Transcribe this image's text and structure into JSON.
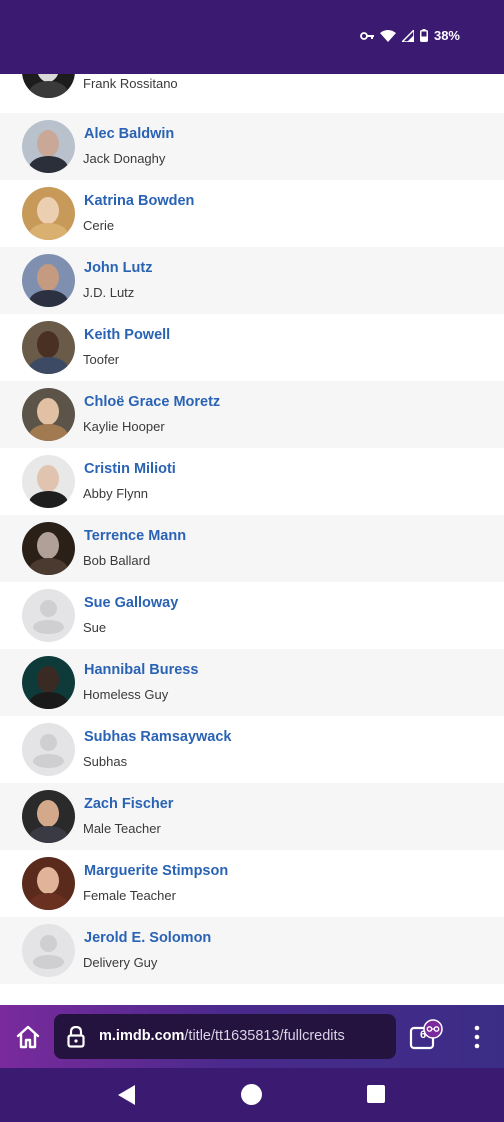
{
  "status_bar": {
    "battery_percent": "38%",
    "icons": [
      "vpn-key-icon",
      "wifi-icon",
      "cell-signal-icon",
      "battery-icon"
    ]
  },
  "cast": [
    {
      "actor": "",
      "character": "Frank Rossitano",
      "avatar": "photo"
    },
    {
      "actor": "Alec Baldwin",
      "character": "Jack Donaghy",
      "avatar": "photo"
    },
    {
      "actor": "Katrina Bowden",
      "character": "Cerie",
      "avatar": "photo"
    },
    {
      "actor": "John Lutz",
      "character": "J.D. Lutz",
      "avatar": "photo"
    },
    {
      "actor": "Keith Powell",
      "character": "Toofer",
      "avatar": "photo"
    },
    {
      "actor": "Chloë Grace Moretz",
      "character": "Kaylie Hooper",
      "avatar": "photo"
    },
    {
      "actor": "Cristin Milioti",
      "character": "Abby Flynn",
      "avatar": "photo"
    },
    {
      "actor": "Terrence Mann",
      "character": "Bob Ballard",
      "avatar": "photo"
    },
    {
      "actor": "Sue Galloway",
      "character": "Sue",
      "avatar": "placeholder"
    },
    {
      "actor": "Hannibal Buress",
      "character": "Homeless Guy",
      "avatar": "photo"
    },
    {
      "actor": "Subhas Ramsaywack",
      "character": "Subhas",
      "avatar": "placeholder"
    },
    {
      "actor": "Zach Fischer",
      "character": "Male Teacher",
      "avatar": "photo"
    },
    {
      "actor": "Marguerite Stimpson",
      "character": "Female Teacher",
      "avatar": "photo"
    },
    {
      "actor": "Jerold E. Solomon",
      "character": "Delivery Guy",
      "avatar": "placeholder"
    }
  ],
  "browser": {
    "url_domain": "m.imdb.com",
    "url_path": "/title/tt1635813/fullcredits",
    "tab_count": "6",
    "icons": [
      "home-icon",
      "lock-icon",
      "incognito-tabs-icon",
      "more-vert-icon"
    ]
  },
  "nav_bar": {
    "icons": [
      "back-icon",
      "home-circle-icon",
      "recents-icon"
    ]
  },
  "colors": {
    "status_bar": "#3b1a72",
    "actor_link": "#2a63b4",
    "row_alt": "#f6f6f7",
    "url_box": "#24123f"
  }
}
